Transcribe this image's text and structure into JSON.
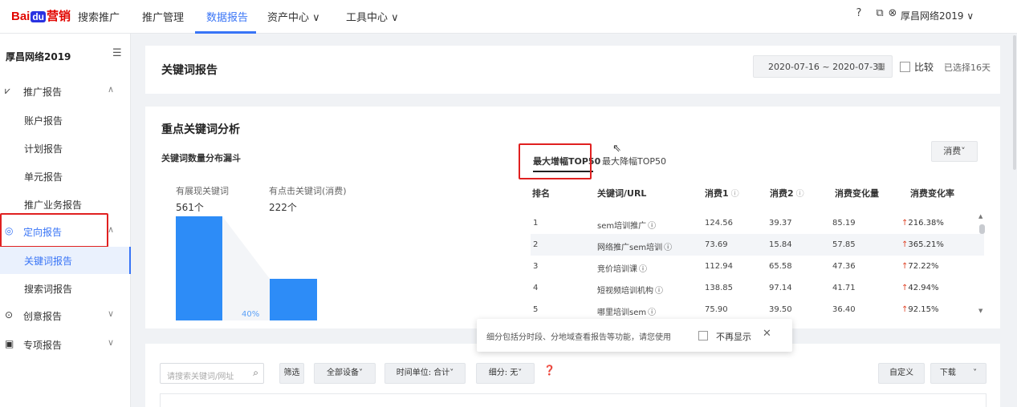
{
  "topbar": {
    "logo_part1": "Bai",
    "logo_paw": "du",
    "logo_part2": "营销",
    "product": "搜索推广",
    "nav": [
      "推广管理",
      "数据报告",
      "资产中心 ∨",
      "工具中心 ∨"
    ],
    "active_nav": "数据报告",
    "icons": [
      "help-icon",
      "copy-icon",
      "user-icon"
    ],
    "account": "厚昌网络2019 ∨"
  },
  "sidebar": {
    "account_name": "厚昌网络2019",
    "groups": [
      {
        "icon": "chart-icon",
        "glyph": "⩗",
        "label": "推广报告",
        "arrow": "∧"
      },
      {
        "icon": "target-icon",
        "glyph": "◎",
        "label": "定向报告",
        "arrow": "∧"
      },
      {
        "icon": "play-icon",
        "glyph": "⊙",
        "label": "创意报告",
        "arrow": "∨"
      },
      {
        "icon": "report-icon",
        "glyph": "▣",
        "label": "专项报告",
        "arrow": "∨"
      }
    ],
    "sub_items": [
      "账户报告",
      "计划报告",
      "单元报告",
      "推广业务报告",
      "关键词报告",
      "搜索词报告"
    ],
    "active_item": "关键词报告"
  },
  "header": {
    "title": "关键词报告",
    "date_range": "2020-07-16 ~ 2020-07-31",
    "compare_label": "比较",
    "selected_days": "已选择16天"
  },
  "analysis": {
    "title": "重点关键词分析",
    "funnel": {
      "title": "关键词数量分布漏斗",
      "label1": "有展现关键词",
      "value1": "561个",
      "label2": "有点击关键词(消费)",
      "value2": "222个",
      "pct": "40%",
      "count1": 561,
      "count2": 222,
      "ratio": 0.4
    },
    "tabs": [
      "最大增幅TOP50",
      "最大降幅TOP50"
    ],
    "metric_dropdown": "消费˅",
    "columns": [
      "排名",
      "关键词/URL",
      "消费1",
      "消费2",
      "消费变化量",
      "消费变化率"
    ],
    "rows": [
      {
        "rank": "1",
        "keyword": "sem培训推广",
        "c1": "124.56",
        "c2": "39.37",
        "delta": "85.19",
        "rate": "216.38%"
      },
      {
        "rank": "2",
        "keyword": "网络推广sem培训",
        "c1": "73.69",
        "c2": "15.84",
        "delta": "57.85",
        "rate": "365.21%"
      },
      {
        "rank": "3",
        "keyword": "竞价培训课",
        "c1": "112.94",
        "c2": "65.58",
        "delta": "47.36",
        "rate": "72.22%"
      },
      {
        "rank": "4",
        "keyword": "短视频培训机构",
        "c1": "138.85",
        "c2": "97.14",
        "delta": "41.71",
        "rate": "42.94%"
      },
      {
        "rank": "5",
        "keyword": "哪里培训sem",
        "c1": "75.90",
        "c2": "39.50",
        "delta": "36.40",
        "rate": "92.15%"
      }
    ],
    "up_arrow": "↑",
    "info_glyph": "ⓘ"
  },
  "toast": {
    "text": "细分包括分时段、分地域查看报告等功能，请您使用",
    "checkbox_label": "不再显示",
    "close": "✕"
  },
  "bottom": {
    "search_placeholder": "请搜索关键词/网址",
    "filters": [
      "筛选",
      "全部设备˅",
      "时间单位: 合计˅",
      "细分: 无˅"
    ],
    "custom": "自定义",
    "download": "下载",
    "download_arrow": "˅"
  }
}
